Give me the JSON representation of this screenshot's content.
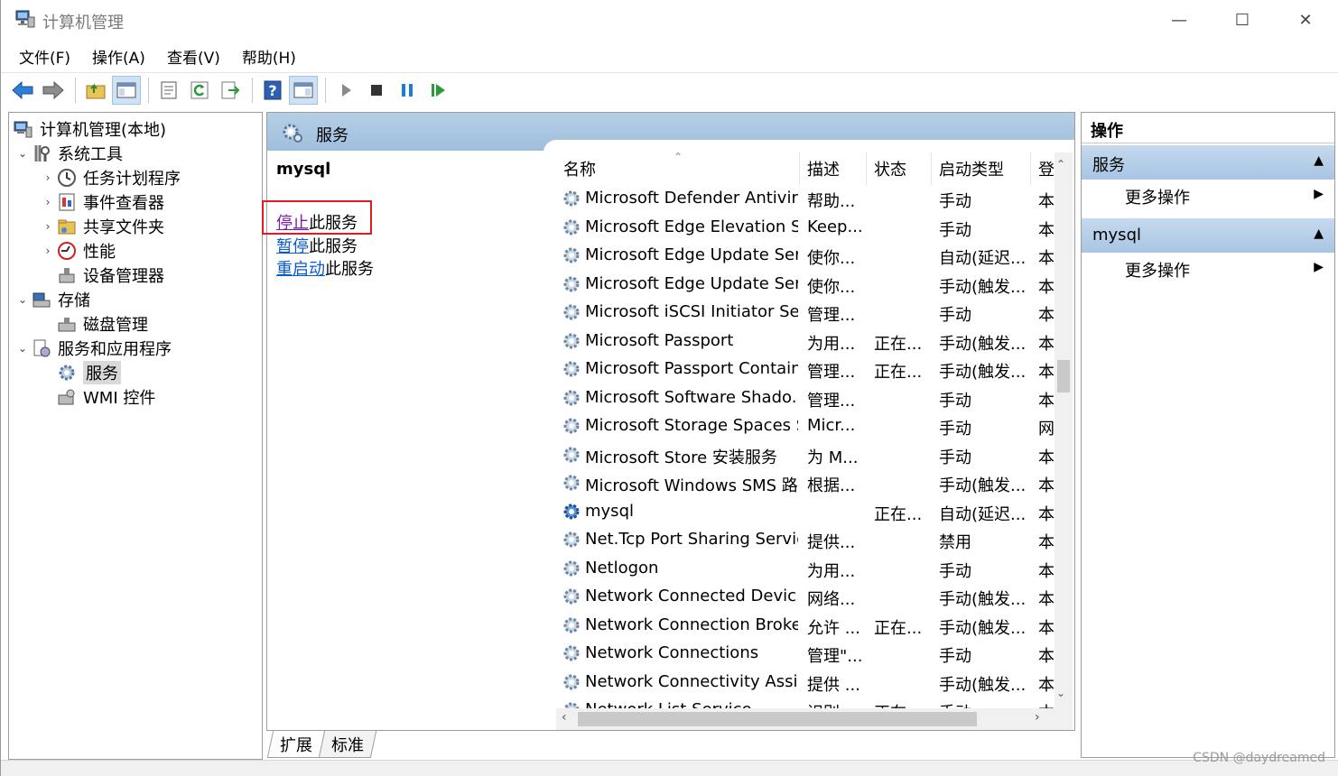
{
  "window": {
    "title": "计算机管理",
    "minimize": "—",
    "maximize": "☐",
    "close": "✕"
  },
  "menu": [
    {
      "label": "文件(F)"
    },
    {
      "label": "操作(A)"
    },
    {
      "label": "查看(V)"
    },
    {
      "label": "帮助(H)"
    }
  ],
  "tree": {
    "root": "计算机管理(本地)",
    "system_tools": "系统工具",
    "task_scheduler": "任务计划程序",
    "event_viewer": "事件查看器",
    "shared_folders": "共享文件夹",
    "performance": "性能",
    "device_manager": "设备管理器",
    "storage": "存储",
    "disk_management": "磁盘管理",
    "services_apps": "服务和应用程序",
    "services": "服务",
    "wmi": "WMI 控件"
  },
  "center": {
    "header_title": "服务",
    "selected_service": "mysql",
    "actions": [
      {
        "link": "停止",
        "rest": "此服务"
      },
      {
        "link": "暂停",
        "rest": "此服务"
      },
      {
        "link": "重启动",
        "rest": "此服务"
      }
    ]
  },
  "list": {
    "columns": {
      "name": "名称",
      "desc": "描述",
      "status": "状态",
      "startup": "启动类型",
      "logon": "登"
    },
    "rows": [
      {
        "name": "Microsoft Defender Antivir...",
        "desc": "帮助...",
        "status": "",
        "startup": "手动",
        "logon": "本"
      },
      {
        "name": "Microsoft Edge Elevation S...",
        "desc": "Keep...",
        "status": "",
        "startup": "手动",
        "logon": "本"
      },
      {
        "name": "Microsoft Edge Update Ser...",
        "desc": "使你...",
        "status": "",
        "startup": "自动(延迟...",
        "logon": "本"
      },
      {
        "name": "Microsoft Edge Update Ser...",
        "desc": "使你...",
        "status": "",
        "startup": "手动(触发...",
        "logon": "本"
      },
      {
        "name": "Microsoft iSCSI Initiator Ser...",
        "desc": "管理...",
        "status": "",
        "startup": "手动",
        "logon": "本"
      },
      {
        "name": "Microsoft Passport",
        "desc": "为用...",
        "status": "正在...",
        "startup": "手动(触发...",
        "logon": "本"
      },
      {
        "name": "Microsoft Passport Container",
        "desc": "管理...",
        "status": "正在...",
        "startup": "手动(触发...",
        "logon": "本"
      },
      {
        "name": "Microsoft Software Shado...",
        "desc": "管理...",
        "status": "",
        "startup": "手动",
        "logon": "本"
      },
      {
        "name": "Microsoft Storage Spaces S...",
        "desc": "Micr...",
        "status": "",
        "startup": "手动",
        "logon": "网"
      },
      {
        "name": "Microsoft Store 安装服务",
        "desc": "为 M...",
        "status": "",
        "startup": "手动",
        "logon": "本"
      },
      {
        "name": "Microsoft Windows SMS 路...",
        "desc": "根据...",
        "status": "",
        "startup": "手动(触发...",
        "logon": "本"
      },
      {
        "name": "mysql",
        "desc": "",
        "status": "正在...",
        "startup": "自动(延迟...",
        "logon": "本"
      },
      {
        "name": "Net.Tcp Port Sharing Service",
        "desc": "提供...",
        "status": "",
        "startup": "禁用",
        "logon": "本"
      },
      {
        "name": "Netlogon",
        "desc": "为用...",
        "status": "",
        "startup": "手动",
        "logon": "本"
      },
      {
        "name": "Network Connected Devic...",
        "desc": "网络...",
        "status": "",
        "startup": "手动(触发...",
        "logon": "本"
      },
      {
        "name": "Network Connection Broker",
        "desc": "允许 ...",
        "status": "正在...",
        "startup": "手动(触发...",
        "logon": "本"
      },
      {
        "name": "Network Connections",
        "desc": "管理\"...",
        "status": "",
        "startup": "手动",
        "logon": "本"
      },
      {
        "name": "Network Connectivity Assis...",
        "desc": "提供 ...",
        "status": "",
        "startup": "手动(触发...",
        "logon": "本"
      },
      {
        "name": "Network List Service",
        "desc": "识别...",
        "status": "正在...",
        "startup": "手动",
        "logon": "本"
      }
    ]
  },
  "tabs": {
    "extended": "扩展",
    "standard": "标准"
  },
  "actions_pane": {
    "title": "操作",
    "section1": "服务",
    "section1_item": "更多操作",
    "section2": "mysql",
    "section2_item": "更多操作"
  },
  "watermark": "CSDN @daydreamed",
  "colors": {
    "link": "#0b5ad4",
    "visited_link": "#7a1aa6",
    "highlight_box": "#e21a23",
    "header_blue": "#a9c5e3"
  }
}
